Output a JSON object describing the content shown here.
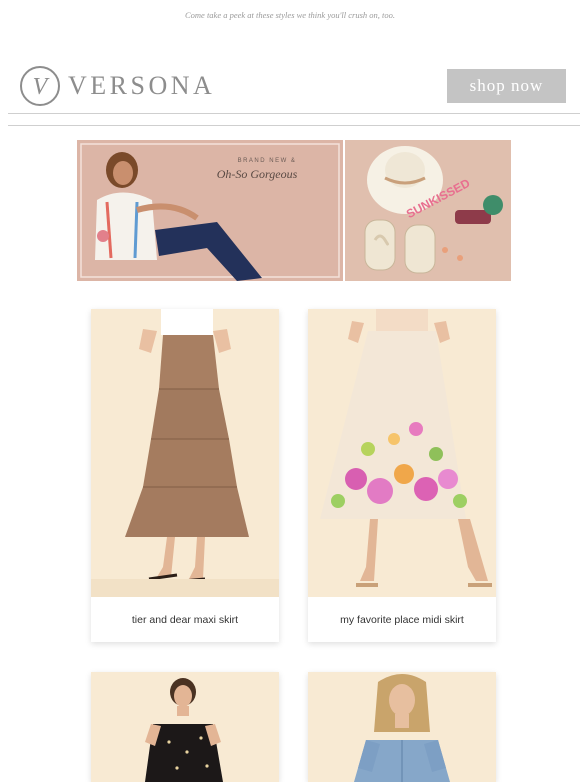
{
  "preheader": "Come take a peek at these styles we think you'll crush on, too.",
  "brand": {
    "name": "VERSONA",
    "logo_mark": "V"
  },
  "header": {
    "shop_now_label": "shop now"
  },
  "hero": {
    "left_top": "BRAND NEW &",
    "left_script": "Oh-So Gorgeous",
    "right_hat_text": "SUNKISSED"
  },
  "products": [
    {
      "name": "tier and dear maxi skirt"
    },
    {
      "name": "my favorite place midi skirt"
    }
  ],
  "colors": {
    "shop_button": "#c4c4c4",
    "logo_gray": "#8d8d8d",
    "card_background": "#f8ead3"
  }
}
